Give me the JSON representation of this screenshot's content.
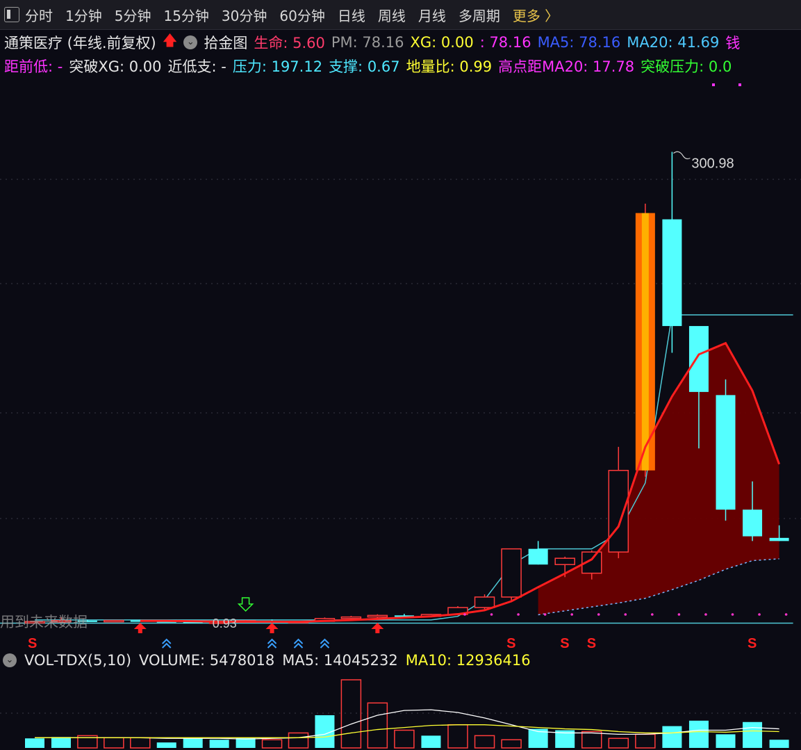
{
  "toolbar": {
    "tabs": [
      "分时",
      "1分钟",
      "5分钟",
      "15分钟",
      "30分钟",
      "60分钟",
      "日线",
      "周线",
      "月线",
      "多周期"
    ],
    "more": "更多 〉"
  },
  "header": {
    "row1": [
      {
        "text": "通策医疗 (年线.前复权)",
        "color": "#e6e6e6"
      },
      {
        "text": "拾金图",
        "color": "#e6e6e6"
      },
      {
        "text": "生命: 5.60",
        "color": "#ff3b6b"
      },
      {
        "text": "PM: 78.16",
        "color": "#9a9a9a"
      },
      {
        "text": "XG: 0.00",
        "color": "#ffff33"
      },
      {
        "text": ": 78.16",
        "color": "#ff33ff"
      },
      {
        "text": "MA5: 78.16",
        "color": "#3a5cff"
      },
      {
        "text": "MA20: 41.69",
        "color": "#4ec9ff"
      },
      {
        "text": "钱",
        "color": "#ff33ff"
      }
    ],
    "row2": [
      {
        "text": "距前低: -",
        "color": "#ff33ff"
      },
      {
        "text": "突破XG: 0.00",
        "color": "#e6e6e6"
      },
      {
        "text": "近低支: -",
        "color": "#e6e6e6"
      },
      {
        "text": "压力: 197.12",
        "color": "#4ee8ff"
      },
      {
        "text": "支撑: 0.67",
        "color": "#4ee8ff"
      },
      {
        "text": "地量比: 0.99",
        "color": "#ffff33"
      },
      {
        "text": "高点距MA20: 17.78",
        "color": "#ff33ff"
      },
      {
        "text": "突破压力: 0.0",
        "color": "#33ff33"
      }
    ]
  },
  "volume_header": {
    "name": "VOL-TDX(5,10)",
    "volume": "VOLUME: 5478018",
    "ma5": "MA5: 14045232",
    "ma10": "MA10: 12936416"
  },
  "annotations": {
    "high_label": "300.98",
    "low_label": "0.93",
    "sell_signal": "S",
    "overlay_text": "用到未来数据"
  },
  "colors": {
    "up": "#ff3b3b",
    "down": "#54ffff",
    "ma": "#ff1f1f",
    "pressure": "#4ec9d6",
    "band": "#6a0000",
    "volume_ma5": "#ffffff",
    "volume_ma10": "#ffff33"
  },
  "chart_data": [
    {
      "type": "candlestick",
      "period": "年线",
      "ylim": [
        0,
        330
      ],
      "candles": [
        {
          "o": 1.2,
          "h": 2.0,
          "l": 0.95,
          "c": 1.7
        },
        {
          "o": 1.7,
          "h": 4.5,
          "l": 1.3,
          "c": 2.3
        },
        {
          "o": 2.3,
          "h": 2.8,
          "l": 1.4,
          "c": 2.0
        },
        {
          "o": 2.0,
          "h": 2.6,
          "l": 1.5,
          "c": 2.4
        },
        {
          "o": 2.4,
          "h": 2.8,
          "l": 1.6,
          "c": 1.9
        },
        {
          "o": 1.9,
          "h": 2.2,
          "l": 1.2,
          "c": 1.5
        },
        {
          "o": 1.5,
          "h": 1.7,
          "l": 0.93,
          "c": 1.0
        },
        {
          "o": 1.0,
          "h": 1.6,
          "l": 0.95,
          "c": 1.4
        },
        {
          "o": 1.4,
          "h": 2.6,
          "l": 1.3,
          "c": 2.2
        },
        {
          "o": 2.2,
          "h": 3.0,
          "l": 1.2,
          "c": 1.3
        },
        {
          "o": 1.3,
          "h": 2.0,
          "l": 1.0,
          "c": 1.8
        },
        {
          "o": 1.8,
          "h": 4.3,
          "l": 1.6,
          "c": 3.6
        },
        {
          "o": 3.6,
          "h": 5.3,
          "l": 2.6,
          "c": 4.6
        },
        {
          "o": 4.6,
          "h": 6.3,
          "l": 3.6,
          "c": 5.6
        },
        {
          "o": 5.6,
          "h": 6.6,
          "l": 4.5,
          "c": 5.0
        },
        {
          "o": 5.0,
          "h": 6.6,
          "l": 4.4,
          "c": 6.2
        },
        {
          "o": 6.2,
          "h": 11.5,
          "l": 5.6,
          "c": 10.6
        },
        {
          "o": 10.6,
          "h": 19.0,
          "l": 9.6,
          "c": 17.3
        },
        {
          "o": 17.3,
          "h": 36.0,
          "l": 15.3,
          "c": 48.0
        },
        {
          "o": 48.0,
          "h": 53.0,
          "l": 38.0,
          "c": 38.0
        },
        {
          "o": 38.0,
          "h": 43.0,
          "l": 30.0,
          "c": 42.0
        },
        {
          "o": 32.5,
          "h": 47.0,
          "l": 28.5,
          "c": 46.0
        },
        {
          "o": 46.0,
          "h": 113.0,
          "l": 42.0,
          "c": 98.0
        },
        {
          "o": 98.0,
          "h": 268.0,
          "l": 94.0,
          "c": 262.0
        },
        {
          "o": 258.0,
          "h": 300.98,
          "l": 173.0,
          "c": 190.0
        },
        {
          "o": 190.0,
          "h": 189.0,
          "l": 112.0,
          "c": 148.0
        },
        {
          "o": 146.0,
          "h": 156.0,
          "l": 66.0,
          "c": 73.0
        },
        {
          "o": 73.0,
          "h": 91.0,
          "l": 53.0,
          "c": 56.0
        },
        {
          "o": 55.0,
          "h": 63.0,
          "l": 53.0,
          "c": 53.0
        }
      ],
      "ma5": [
        null,
        null,
        null,
        null,
        2.1,
        2.1,
        1.9,
        1.6,
        1.6,
        1.6,
        1.5,
        2.1,
        2.6,
        3.4,
        4.2,
        5.0,
        6.4,
        8.9,
        14.6,
        23.6,
        32.3,
        41.3,
        62.3,
        112.9,
        145.2,
        171.9,
        179.1,
        148.8,
        102.0
      ],
      "pressure": [
        2.7,
        2.7,
        2.7,
        2.7,
        2.7,
        2.7,
        2.7,
        2.7,
        2.7,
        2.7,
        2.7,
        2.7,
        2.7,
        2.7,
        2.7,
        2.7,
        5.0,
        15.6,
        38.0,
        48.0,
        48.0,
        48.0,
        58.0,
        90.0,
        197.12,
        197.12,
        197.12,
        197.12,
        197.12
      ],
      "support": [
        0.67,
        0.67,
        0.67,
        0.67,
        0.67,
        0.67,
        0.67,
        0.67,
        0.67,
        0.67,
        0.67,
        0.67,
        0.67,
        0.67,
        0.67,
        0.67,
        0.67,
        0.67,
        0.67,
        0.67,
        0.67,
        0.67,
        0.67,
        0.67,
        0.67,
        0.67,
        0.67,
        0.67,
        0.67
      ],
      "ma20": [
        null,
        null,
        null,
        null,
        null,
        null,
        null,
        null,
        null,
        null,
        null,
        null,
        null,
        null,
        null,
        null,
        null,
        null,
        null,
        6.0,
        8.5,
        11.0,
        13.5,
        16.5,
        22.0,
        28.0,
        35.0,
        40.5,
        41.69
      ],
      "sell_signals": [
        18,
        20,
        21,
        27
      ],
      "buy_arrows": [
        4,
        9,
        13
      ],
      "buy_markers": [
        5,
        9,
        10,
        11
      ]
    },
    {
      "type": "bar",
      "title": "VOL-TDX(5,10)",
      "ylim": [
        0,
        100
      ],
      "values": [
        14,
        16,
        18,
        15,
        15,
        8,
        15,
        12,
        15,
        12,
        22,
        48,
        100,
        66,
        26,
        18,
        34,
        18,
        12,
        28,
        26,
        24,
        14,
        20,
        32,
        40,
        20,
        38,
        12
      ],
      "up": [
        false,
        false,
        true,
        true,
        true,
        false,
        false,
        false,
        false,
        true,
        true,
        false,
        true,
        true,
        true,
        false,
        true,
        true,
        true,
        false,
        false,
        true,
        true,
        true,
        false,
        false,
        false,
        false,
        false
      ],
      "ma5": [
        15,
        15,
        15,
        15,
        15,
        14,
        14,
        14,
        13,
        14,
        15,
        20,
        35,
        48,
        55,
        56,
        52,
        44,
        34,
        24,
        22,
        22,
        20,
        20,
        22,
        26,
        26,
        30,
        28
      ],
      "ma10": [
        15,
        15,
        15,
        15,
        15,
        15,
        15,
        15,
        15,
        15,
        15,
        16,
        22,
        27,
        30,
        33,
        34,
        34,
        32,
        30,
        28,
        27,
        24,
        22,
        22,
        24,
        23,
        25,
        24
      ]
    }
  ]
}
